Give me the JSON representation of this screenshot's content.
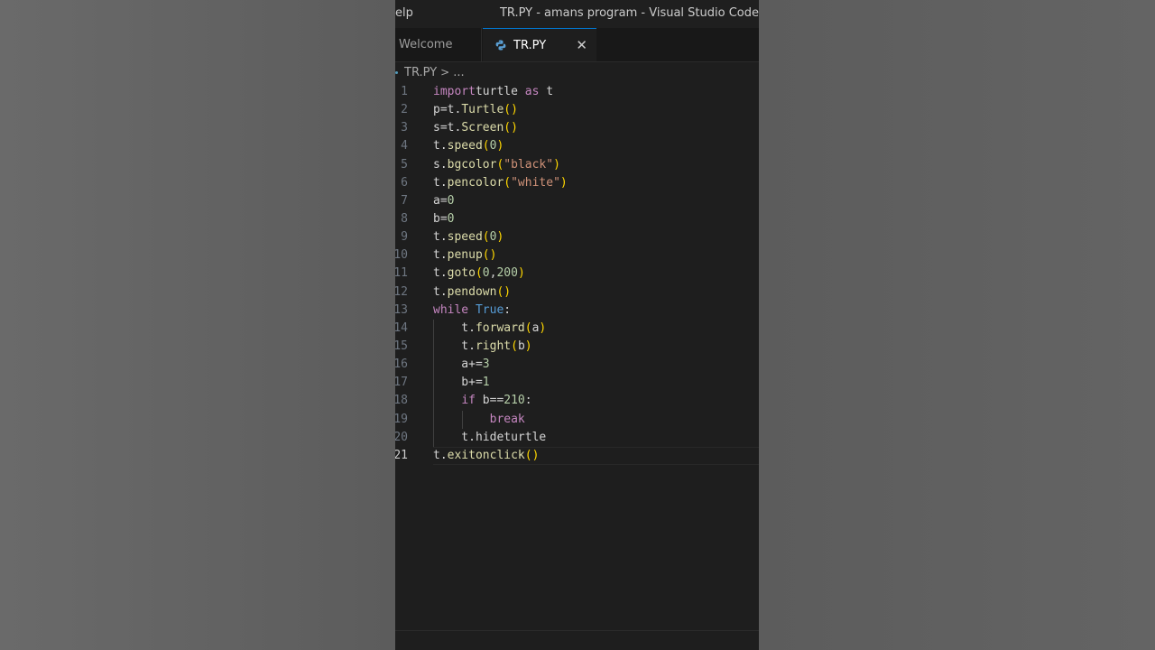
{
  "window": {
    "menu_partial": "elp",
    "title": "TR.PY - amans program - Visual Studio Code"
  },
  "tabs": [
    {
      "label": "Welcome",
      "active": false
    },
    {
      "label": "TR.PY",
      "active": true,
      "close_glyph": "✕"
    }
  ],
  "breadcrumb": {
    "file": "TR.PY",
    "separator": ">",
    "rest": "..."
  },
  "editor": {
    "current_line": 21,
    "lines": [
      {
        "n": "1",
        "tokens": [
          [
            "kw",
            "import"
          ],
          [
            "",
            "turtle "
          ],
          [
            "kw",
            "as"
          ],
          [
            "",
            " t"
          ]
        ]
      },
      {
        "n": "2",
        "tokens": [
          [
            "",
            "p=t."
          ],
          [
            "fn",
            "Turtle"
          ],
          [
            "p1",
            "()"
          ]
        ]
      },
      {
        "n": "3",
        "tokens": [
          [
            "",
            "s=t."
          ],
          [
            "fn",
            "Screen"
          ],
          [
            "p1",
            "()"
          ]
        ]
      },
      {
        "n": "4",
        "tokens": [
          [
            "",
            "t."
          ],
          [
            "fn",
            "speed"
          ],
          [
            "p1",
            "("
          ],
          [
            "num",
            "0"
          ],
          [
            "p1",
            ")"
          ]
        ]
      },
      {
        "n": "5",
        "tokens": [
          [
            "",
            "s."
          ],
          [
            "fn",
            "bgcolor"
          ],
          [
            "p1",
            "("
          ],
          [
            "str",
            "\"black\""
          ],
          [
            "p1",
            ")"
          ]
        ]
      },
      {
        "n": "6",
        "tokens": [
          [
            "",
            "t."
          ],
          [
            "fn",
            "pencolor"
          ],
          [
            "p1",
            "("
          ],
          [
            "str",
            "\"white\""
          ],
          [
            "p1",
            ")"
          ]
        ]
      },
      {
        "n": "7",
        "tokens": [
          [
            "",
            "a="
          ],
          [
            "num",
            "0"
          ]
        ]
      },
      {
        "n": "8",
        "tokens": [
          [
            "",
            "b="
          ],
          [
            "num",
            "0"
          ]
        ]
      },
      {
        "n": "9",
        "tokens": [
          [
            "",
            "t."
          ],
          [
            "fn",
            "speed"
          ],
          [
            "p1",
            "("
          ],
          [
            "num",
            "0"
          ],
          [
            "p1",
            ")"
          ]
        ]
      },
      {
        "n": "10",
        "tokens": [
          [
            "",
            "t."
          ],
          [
            "fn",
            "penup"
          ],
          [
            "p1",
            "()"
          ]
        ]
      },
      {
        "n": "11",
        "tokens": [
          [
            "",
            "t."
          ],
          [
            "fn",
            "goto"
          ],
          [
            "p1",
            "("
          ],
          [
            "num",
            "0"
          ],
          [
            "",
            ","
          ],
          [
            "num",
            "200"
          ],
          [
            "p1",
            ")"
          ]
        ]
      },
      {
        "n": "12",
        "tokens": [
          [
            "",
            "t."
          ],
          [
            "fn",
            "pendown"
          ],
          [
            "p1",
            "()"
          ]
        ]
      },
      {
        "n": "13",
        "tokens": [
          [
            "kw",
            "while"
          ],
          [
            "",
            " "
          ],
          [
            "kw2",
            "True"
          ],
          [
            "",
            ":"
          ]
        ]
      },
      {
        "n": "14",
        "tokens": [
          [
            "",
            "    t."
          ],
          [
            "fn",
            "forward"
          ],
          [
            "p1",
            "("
          ],
          [
            "",
            "a"
          ],
          [
            "p1",
            ")"
          ]
        ]
      },
      {
        "n": "15",
        "tokens": [
          [
            "",
            "    t."
          ],
          [
            "fn",
            "right"
          ],
          [
            "p1",
            "("
          ],
          [
            "",
            "b"
          ],
          [
            "p1",
            ")"
          ]
        ]
      },
      {
        "n": "16",
        "tokens": [
          [
            "",
            "    a+="
          ],
          [
            "num",
            "3"
          ]
        ]
      },
      {
        "n": "17",
        "tokens": [
          [
            "",
            "    b+="
          ],
          [
            "num",
            "1"
          ]
        ]
      },
      {
        "n": "18",
        "tokens": [
          [
            "",
            "    "
          ],
          [
            "kw",
            "if"
          ],
          [
            "",
            " b=="
          ],
          [
            "num",
            "210"
          ],
          [
            "",
            ":"
          ]
        ]
      },
      {
        "n": "19",
        "tokens": [
          [
            "",
            "        "
          ],
          [
            "kw",
            "break"
          ]
        ]
      },
      {
        "n": "20",
        "tokens": [
          [
            "",
            "    t.hideturtle"
          ]
        ]
      },
      {
        "n": "21",
        "tokens": [
          [
            "",
            "t."
          ],
          [
            "fn",
            "exitonclick"
          ],
          [
            "p1",
            "()"
          ]
        ]
      }
    ]
  },
  "colors": {
    "keyword": "#c586c0",
    "constant": "#569cd6",
    "function": "#dcdcaa",
    "string": "#ce9178",
    "number": "#b5cea8",
    "bracket": "#ffd700",
    "accent": "#0078d4"
  }
}
